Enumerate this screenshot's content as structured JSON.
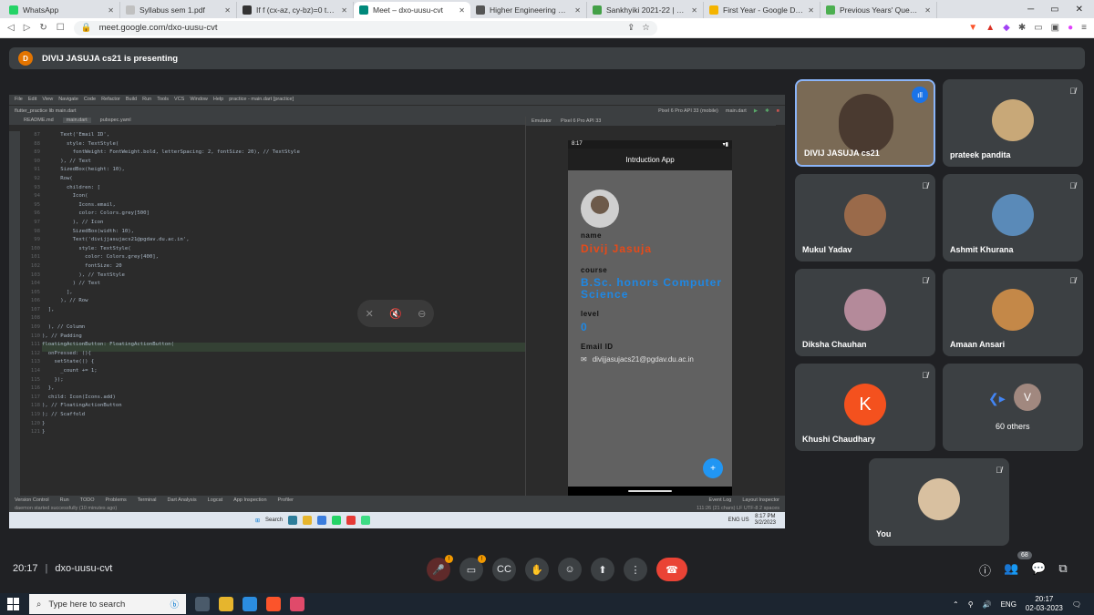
{
  "browser": {
    "tabs": [
      {
        "label": "WhatsApp",
        "color": "#25d366",
        "active": false
      },
      {
        "label": "Syllabus sem 1.pdf",
        "color": "#c0c0c0",
        "active": false
      },
      {
        "label": "If f (cx-az, cy-bz)=0 then show",
        "color": "#333333",
        "active": false
      },
      {
        "label": "Meet – dxo-uusu-cvt",
        "color": "#00897b",
        "active": true
      },
      {
        "label": "Higher Engineering Mathematic",
        "color": "#555555",
        "active": false
      },
      {
        "label": "Sankhyiki 2021-22 | Linktree",
        "color": "#43a047",
        "active": false
      },
      {
        "label": "First Year - Google Drive",
        "color": "#f4b400",
        "active": false
      },
      {
        "label": "Previous Years' Question Papers",
        "color": "#4caf50",
        "active": false
      }
    ],
    "url": "meet.google.com/dxo-uusu-cvt"
  },
  "presenting": {
    "initial": "D",
    "text": "DIVIJ JASUJA cs21 is presenting"
  },
  "ide": {
    "menu": [
      "File",
      "Edit",
      "View",
      "Navigate",
      "Code",
      "Refactor",
      "Build",
      "Run",
      "Tools",
      "VCS",
      "Window",
      "Help",
      "practice - main.dart [practice]"
    ],
    "breadcrumb": "flutter_practice  lib  main.dart",
    "device": "Pixel 6 Pro API 33 (mobile)",
    "run_config": "main.dart",
    "file_tabs": [
      "README.md",
      "main.dart",
      "pubspec.yaml"
    ],
    "emulator_tabs": [
      "Emulator",
      "Pixel 6 Pro API 33"
    ],
    "line_numbers": "87\n88\n89\n90\n91\n92\n93\n94\n95\n96\n97\n98\n99\n100\n101\n102\n103\n104\n105\n106\n107\n108\n109\n110\n111\n112\n113\n114\n115\n116\n117\n118\n119\n120\n121",
    "code": "      Text('Email ID',\n        style: TextStyle(\n          fontWeight: FontWeight.bold, letterSpacing: 2, fontSize: 20), // TextStyle\n      ), // Text\n      SizedBox(height: 10),\n      Row(\n        children: [\n          Icon(\n            Icons.email,\n            color: Colors.grey[500]\n          ), // Icon\n          SizedBox(width: 10),\n          Text('divijjasujacs21@pgdav.du.ac.in',\n            style: TextStyle(\n              color: Colors.grey[400],\n              fontSize: 20\n            ), // TextStyle\n          ) // Text\n        ],\n      ), // Row\n  ],\n\n  ), // Column\n), // Padding\nfloatingActionButton: FloatingActionButton(\n  onPressed: (){\n    setState(() {\n      _count += 1;\n    });\n  },\n  child: Icon(Icons.add)\n), // FloatingActionButton\n); // Scaffold\n}\n}",
    "bottom_tools": [
      "Version Control",
      "Run",
      "TODO",
      "Problems",
      "Terminal",
      "Dart Analysis",
      "Logcat",
      "App Inspection",
      "Profiler",
      "Event Log",
      "Layout Inspector"
    ],
    "status_msg": "daemon started successfully (10 minutes ago)",
    "cursor": "111:26 (21 chars)   LF   UTF-8   2 spaces"
  },
  "phone": {
    "time": "8:17",
    "app_title": "Intrduction App",
    "name_label": "name",
    "name_value": "Divij Jasuja",
    "course_label": "course",
    "course_value": "B.Sc. honors Computer Science",
    "level_label": "level",
    "level_value": "0",
    "email_label": "Email ID",
    "email_value": "divijjasujacs21@pgdav.du.ac.in",
    "fab_icon": "add-icon"
  },
  "inner_taskbar": {
    "search": "Search",
    "lang": "ENG\nUS",
    "time": "8:17 PM",
    "date": "3/2/2023"
  },
  "participants": [
    {
      "name": "DIVIJ JASUJA cs21",
      "speaking": true,
      "color": "#7a6a55"
    },
    {
      "name": "prateek pandita",
      "color": "#c8a878"
    },
    {
      "name": "Mukul Yadav",
      "color": "#9a6a4a"
    },
    {
      "name": "Ashmit Khurana",
      "color": "#5a8ab8"
    },
    {
      "name": "Diksha Chauhan",
      "color": "#b48a9a"
    },
    {
      "name": "Amaan Ansari",
      "color": "#c48848"
    },
    {
      "name": "Khushi Chaudhary",
      "initial": "K",
      "color": "#f4511e"
    },
    {
      "name": "60 others",
      "initial": "V",
      "color": "#a1887f"
    },
    {
      "name": "You",
      "color": "#d8c0a0"
    }
  ],
  "meeting": {
    "time": "20:17",
    "code": "dxo-uusu-cvt",
    "participant_count": "68"
  },
  "taskbar": {
    "search_placeholder": "Type here to search",
    "lang": "ENG",
    "time": "20:17",
    "date": "02-03-2023"
  }
}
